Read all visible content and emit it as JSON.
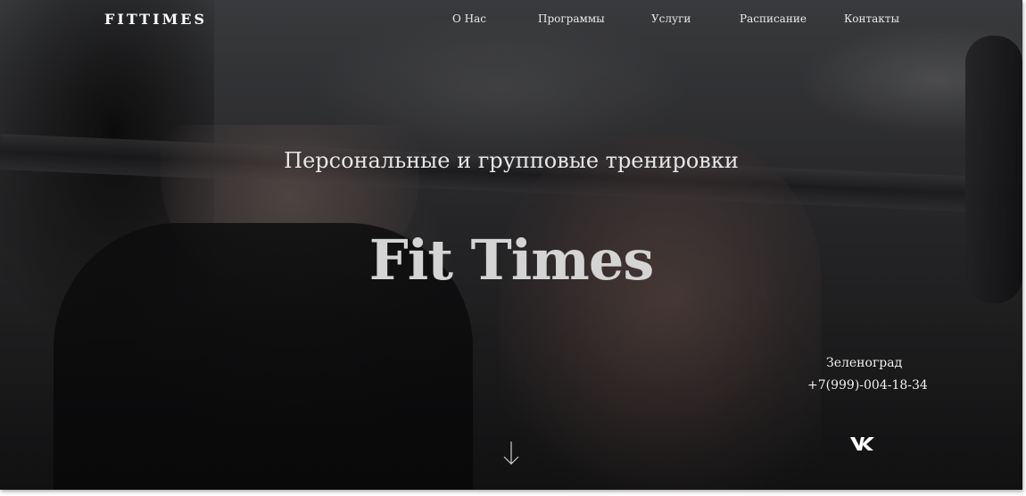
{
  "header": {
    "logo": "FITTIMES",
    "nav": [
      {
        "label": "О Нас"
      },
      {
        "label": "Программы"
      },
      {
        "label": "Услуги"
      },
      {
        "label": "Расписание"
      },
      {
        "label": "Контакты"
      }
    ]
  },
  "hero": {
    "subtitle": "Персональные и групповые тренировки",
    "title": "Fit Times"
  },
  "contacts": {
    "city": "Зеленоград",
    "phone": "+7(999)-004-18-34"
  },
  "icons": {
    "social": "vk-icon",
    "scroll": "arrow-down-icon"
  },
  "colors": {
    "text": "#ffffff",
    "title": "#d4d4d4",
    "background": "#2c2c2e"
  }
}
